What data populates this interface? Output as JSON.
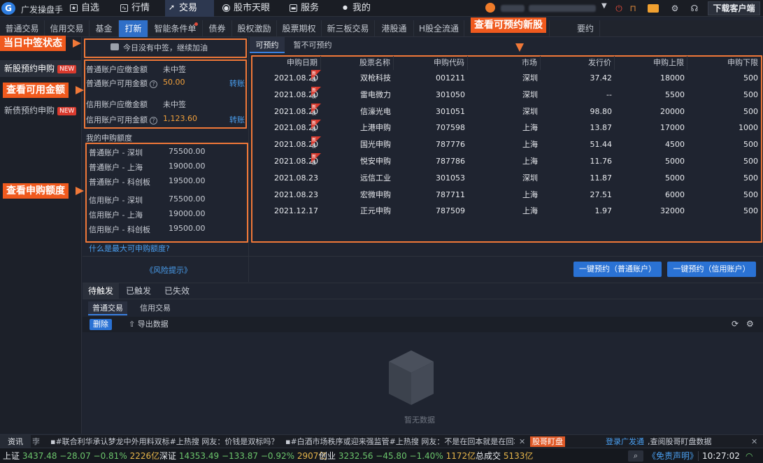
{
  "app": {
    "name": "广发操盘手",
    "download_label": "下载客户端"
  },
  "main_nav": [
    {
      "label": "自选",
      "icon": "star-icon"
    },
    {
      "label": "行情",
      "icon": "chart-icon"
    },
    {
      "label": "交易",
      "icon": "trade-icon"
    },
    {
      "label": "股市天眼",
      "icon": "eye-icon"
    },
    {
      "label": "服务",
      "icon": "briefcase-icon"
    },
    {
      "label": "我的",
      "icon": "user-icon"
    }
  ],
  "sub_tabs": [
    "普通交易",
    "信用交易",
    "基金",
    "打新",
    "智能条件单",
    "债券",
    "股权激励",
    "股票期权",
    "新三板交易",
    "港股通",
    "H股全流通",
    "",
    "要约"
  ],
  "sidebar": {
    "items": [
      {
        "label": "新股预约申购",
        "badge": "NEW"
      },
      {
        "label": "新债预约申购",
        "badge": "NEW"
      }
    ]
  },
  "status_box": {
    "text": "今日没有中签，继续加油"
  },
  "amounts": {
    "normal_due_label": "普通账户应缴金额",
    "normal_due_value": "未中签",
    "normal_avail_label": "普通账户可用金额",
    "normal_avail_value": "50.00",
    "credit_due_label": "信用账户应缴金额",
    "credit_due_value": "未中签",
    "credit_avail_label": "信用账户可用金额",
    "credit_avail_value": "1,123.60",
    "transfer_label": "转账"
  },
  "quota": {
    "title": "我的申购额度",
    "rows": [
      {
        "label": "普通账户 - 深圳",
        "value": "75500.00"
      },
      {
        "label": "普通账户 - 上海",
        "value": "19000.00"
      },
      {
        "label": "普通账户 - 科创板",
        "value": "19500.00"
      },
      {
        "label": "信用账户 - 深圳",
        "value": "75500.00"
      },
      {
        "label": "信用账户 - 上海",
        "value": "19000.00"
      },
      {
        "label": "信用账户 - 科创板",
        "value": "19500.00"
      }
    ],
    "help_link": "什么是最大可申购额度?",
    "risk_link": "《风险提示》"
  },
  "callouts": {
    "status": "当日中签状态",
    "available": "查看可用金额",
    "quota": "查看申购额度",
    "subscribe": "查看可预约新股"
  },
  "table_tabs": [
    "可预约",
    "暂不可预约"
  ],
  "table": {
    "headers": [
      "申购日期",
      "股票名称",
      "申购代码",
      "市场",
      "发行价",
      "申购上限",
      "申购下限"
    ],
    "tag_label": "新股",
    "rows": [
      {
        "date": "2021.08.20",
        "name": "双枪科技",
        "code": "001211",
        "market": "深圳",
        "price": "37.42",
        "max": "18000",
        "min": "500",
        "tag": true
      },
      {
        "date": "2021.08.20",
        "name": "雷电微力",
        "code": "301050",
        "market": "深圳",
        "price": "--",
        "max": "5500",
        "min": "500",
        "tag": true
      },
      {
        "date": "2021.08.20",
        "name": "信濠光电",
        "code": "301051",
        "market": "深圳",
        "price": "98.80",
        "max": "20000",
        "min": "500",
        "tag": true
      },
      {
        "date": "2021.08.20",
        "name": "上港申购",
        "code": "707598",
        "market": "上海",
        "price": "13.87",
        "max": "17000",
        "min": "1000",
        "tag": true
      },
      {
        "date": "2021.08.20",
        "name": "国光申购",
        "code": "787776",
        "market": "上海",
        "price": "51.44",
        "max": "4500",
        "min": "500",
        "tag": true
      },
      {
        "date": "2021.08.20",
        "name": "悦安申购",
        "code": "787786",
        "market": "上海",
        "price": "11.76",
        "max": "5000",
        "min": "500",
        "tag": true
      },
      {
        "date": "2021.08.23",
        "name": "远信工业",
        "code": "301053",
        "market": "深圳",
        "price": "11.87",
        "max": "5000",
        "min": "500",
        "tag": false
      },
      {
        "date": "2021.08.23",
        "name": "宏微申购",
        "code": "787711",
        "market": "上海",
        "price": "27.51",
        "max": "6000",
        "min": "500",
        "tag": false
      },
      {
        "date": "2021.12.17",
        "name": "正元申购",
        "code": "787509",
        "market": "上海",
        "price": "1.97",
        "max": "32000",
        "min": "500",
        "tag": false
      }
    ]
  },
  "actions": {
    "normal": "一键预约（普通账户）",
    "credit": "一键预约（信用账户）"
  },
  "bottom": {
    "tabs": [
      "待触发",
      "已触发",
      "已失效"
    ],
    "subtabs": [
      "普通交易",
      "信用交易"
    ],
    "delete_label": "删除",
    "export_label": "导出数据",
    "empty_text": "暂无数据"
  },
  "news": {
    "label": "资讯",
    "label_suffix": "孛",
    "item1": "▪#联合利华承认梦龙中外用料双标#上热搜 网友：价钱是双标吗？",
    "item2": "▪#白酒市场秩序或迎来强监管#上热搜 网友：不是在回本就是在回本",
    "badge": "股哥盯盘",
    "login_link": "登录广发通",
    "login_suffix": ",查阅股哥盯盘数据"
  },
  "indices": {
    "sh_label": "上证",
    "sh_value": "3437.48",
    "sh_change": "−28.07",
    "sh_pct": "−0.81%",
    "sh_amount": "2226亿",
    "sz_label": "深证",
    "sz_value": "14353.49",
    "sz_change": "−133.87",
    "sz_pct": "−0.92%",
    "sz_amount": "2907亿",
    "cy_label": "创业",
    "cy_value": "3232.56",
    "cy_change": "−45.80",
    "cy_pct": "−1.40%",
    "cy_amount": "1172亿",
    "total_label": "总成交",
    "total_value": "5133亿",
    "disclaimer": "《免责声明》",
    "time": "10:27:02"
  },
  "colors": {
    "accent": "#2f6fc8",
    "callout": "#f05a1e",
    "down": "#6bc46b",
    "amount": "#e6b54a"
  }
}
